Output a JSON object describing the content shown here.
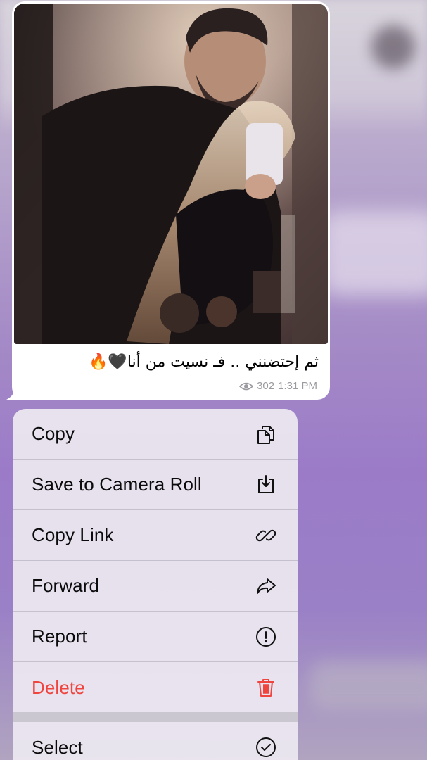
{
  "message": {
    "caption": "ثم إحتضنني .. فـ نسيت من أنا🖤🔥",
    "views": "302",
    "time": "1:31 PM"
  },
  "context_menu": {
    "items": [
      {
        "label": "Copy",
        "icon": "copy-icon"
      },
      {
        "label": "Save to Camera Roll",
        "icon": "download-icon"
      },
      {
        "label": "Copy Link",
        "icon": "link-icon"
      },
      {
        "label": "Forward",
        "icon": "forward-icon"
      },
      {
        "label": "Report",
        "icon": "exclamation-circle-icon"
      },
      {
        "label": "Delete",
        "icon": "trash-icon",
        "color": "#f0443f"
      },
      {
        "label": "Select",
        "icon": "checkmark-circle-icon"
      }
    ]
  },
  "colors": {
    "danger": "#f0443f",
    "meta_text": "#9c9aa1"
  }
}
